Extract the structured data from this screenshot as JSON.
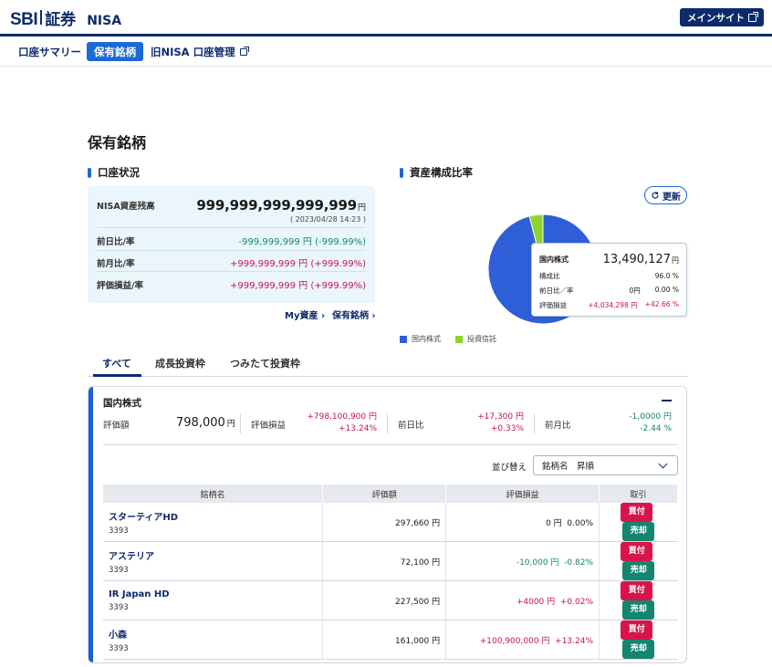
{
  "header": {
    "logo_text": "SBI",
    "logo_suffix": "証券",
    "product": "NISA",
    "main_site_label": "メインサイト"
  },
  "nav": {
    "items": [
      {
        "label": "口座サマリー",
        "active": false
      },
      {
        "label": "保有銘柄",
        "active": true
      },
      {
        "label": "旧NISA 口座管理",
        "active": false
      }
    ]
  },
  "page_title": "保有銘柄",
  "account_status": {
    "heading": "口座状況",
    "balance_label": "NISA資産残高",
    "balance_value": "999,999,999,999,999",
    "balance_unit": "円",
    "as_of": "( 2023/04/28 14:23 )",
    "rows": [
      {
        "label": "前日比/率",
        "value": "-999,999,999 円 (-999.99%)",
        "tone": "neg"
      },
      {
        "label": "前月比/率",
        "value": "+999,999,999 円 (+999.99%)",
        "tone": "pos"
      },
      {
        "label": "評価損益/率",
        "value": "+999,999,999 円 (+999.99%)",
        "tone": "pos"
      }
    ],
    "links": [
      "My資産",
      "保有銘柄"
    ]
  },
  "composition": {
    "heading": "資産構成比率",
    "refresh_label": "更新",
    "tooltip": {
      "name": "国内株式",
      "value": "13,490,127",
      "unit": "円",
      "ratio_label": "構成比",
      "ratio_value": "96.0 %",
      "daychange_label": "前日比／率",
      "daychange_value": "0円",
      "daychange_pct": "0.00 %",
      "pl_label": "評価損益",
      "pl_value": "+4,034,298 円",
      "pl_pct": "+42.66 %"
    },
    "legend": [
      {
        "name": "国内株式",
        "color": "#2f5fd8"
      },
      {
        "name": "投資信託",
        "color": "#8fd42a"
      }
    ]
  },
  "chart_data": {
    "type": "pie",
    "categories": [
      "国内株式",
      "投資信託"
    ],
    "values": [
      96.0,
      4.0
    ],
    "colors": [
      "#2f5fd8",
      "#8fd42a"
    ]
  },
  "tabs": [
    {
      "label": "すべて",
      "active": true
    },
    {
      "label": "成長投資枠",
      "active": false
    },
    {
      "label": "つみたて投資枠",
      "active": false
    }
  ],
  "holdings": {
    "title": "国内株式",
    "summary": {
      "valuation_label": "評価額",
      "valuation_value": "798,000",
      "valuation_unit": "円",
      "pl_label": "評価損益",
      "pl_value": "+798,100,900 円",
      "pl_pct": "+13.24%",
      "day_label": "前日比",
      "day_value": "+17,300 円",
      "day_pct": "+0.33%",
      "month_label": "前月比",
      "month_value": "-1,0000 円",
      "month_pct": "-2.44 %"
    },
    "sort_label": "並び替え",
    "sort_value": "銘柄名　昇順",
    "columns": [
      "銘柄名",
      "評価額",
      "評価損益",
      "取引"
    ],
    "buy_label": "買付",
    "sell_label": "売却",
    "rows": [
      {
        "name": "スターティアHD",
        "code": "3393",
        "valuation": "297,660 円",
        "pl": "0 円",
        "pl_pct": "0.00%",
        "tone": "flat"
      },
      {
        "name": "アステリア",
        "code": "3393",
        "valuation": "72,100 円",
        "pl": "-10,000 円",
        "pl_pct": "-0.82%",
        "tone": "neg"
      },
      {
        "name": "IR Japan HD",
        "code": "3393",
        "valuation": "227,500 円",
        "pl": "+4000 円",
        "pl_pct": "+0.02%",
        "tone": "pos"
      },
      {
        "name": "小森",
        "code": "3393",
        "valuation": "161,000 円",
        "pl": "+100,900,000 円",
        "pl_pct": "+13.24%",
        "tone": "pos"
      }
    ]
  }
}
